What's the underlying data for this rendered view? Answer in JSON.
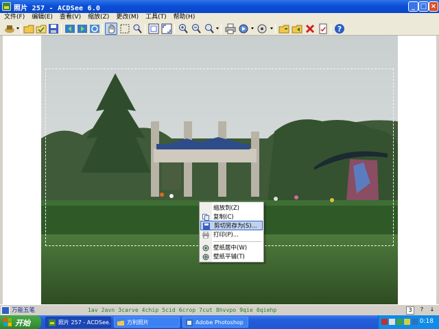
{
  "window": {
    "title": "照片 257 - ACDSee 6.0",
    "buttons": {
      "minimize": "_",
      "maximize": "□",
      "close": "×"
    }
  },
  "menu": [
    "文件(F)",
    "编辑(E)",
    "查看(V)",
    "缩放(Z)",
    "更改(M)",
    "工具(T)",
    "帮助(H)"
  ],
  "toolbar": {
    "icons": [
      "acquire-icon",
      "browse-icon",
      "open-icon",
      "save-icon",
      "previous-image-icon",
      "next-image-icon",
      "rotate-icon",
      "hand-pan-icon",
      "select-icon",
      "magnifier-icon",
      "fit-window-icon",
      "full-screen-icon",
      "zoom-in-icon",
      "zoom-out-icon",
      "zoom-icon",
      "print-icon",
      "slideshow-icon",
      "wallpaper-icon",
      "copy-to-folder-icon",
      "move-to-folder-icon",
      "delete-icon",
      "properties-icon",
      "help-icon"
    ],
    "active_tool": "hand-pan-icon"
  },
  "context_menu": {
    "items": [
      {
        "label": "缩放到(Z)",
        "icon": ""
      },
      {
        "label": "复制(C)",
        "icon": "copy-icon"
      },
      {
        "label": "剪切另存为(S)...",
        "icon": "save-icon"
      },
      {
        "label": "打印(P)...",
        "icon": "print-icon"
      },
      {
        "label": "壁纸居中(W)",
        "icon": "wallpaper-center-icon"
      },
      {
        "label": "壁纸平铺(T)",
        "icon": "wallpaper-tile-icon"
      }
    ],
    "highlighted_index": 2
  },
  "statusbar": {
    "ime_name": "万能五笔",
    "ime_candidates": "1av 2avn 3carve 4chip 5cid 6crop 7cut 8hvvpo 9qie 0qiehp",
    "ime_page": "3",
    "help_box": "?",
    "page_down": "↓"
  },
  "taskbar": {
    "start_label": "开始",
    "tasks": [
      {
        "label": "照片 257 - ACDSee...",
        "active": true
      },
      {
        "label": "万利照片",
        "active": false
      },
      {
        "label": "Adobe Photoshop",
        "active": false
      }
    ],
    "clock": "0:18",
    "colors": {
      "taskbar": "#245edb",
      "start": "#3b9a3b",
      "tray": "#0f8be8"
    }
  }
}
